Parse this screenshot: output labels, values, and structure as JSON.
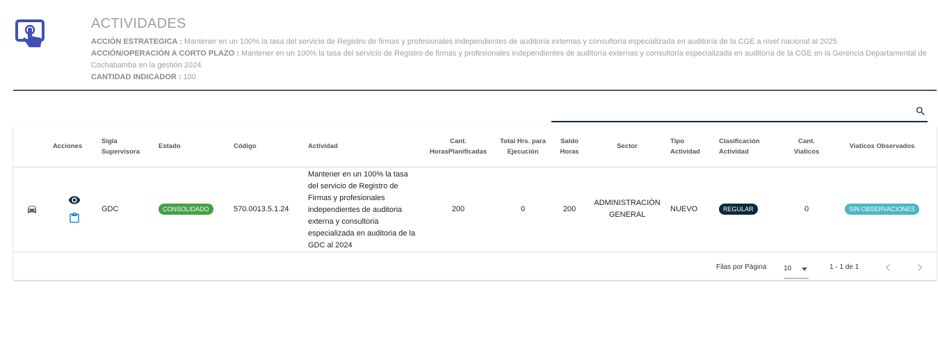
{
  "header": {
    "title": "ACTIVIDADES",
    "accion_estrategica_label": "ACCIÓN ESTRATEGICA :",
    "accion_estrategica_value": " Mantener en un 100% la tasa del servicio de Registro de firmas y profesionales independientes de auditoría externas y consultoría especializada en auditoría de la CGE a nivel nacional al 2025.",
    "accion_corto_plazo_label": "ACCIÓN/OPERACIÓN A CORTO PLAZO :",
    "accion_corto_plazo_value": " Mantener en un 100% la tasa del servicio de Registro de firmas y profesionales independientes de auditoría externas y consultoría especializada en auditoría de la CGE en la Gerencia Departamental de Cochabamba en la gestión 2024.",
    "cantidad_label": "CANTIDAD INDICADOR :",
    "cantidad_value": " 100",
    "icon": "touch-screen-icon"
  },
  "search": {
    "placeholder": "",
    "value": "",
    "icon": "search-icon"
  },
  "table": {
    "headers": {
      "acciones": "Acciones",
      "sigla": "Sigla Supervisora",
      "estado": "Estado",
      "codigo": "Código",
      "actividad": "Actividad",
      "cant_horas": "Cant. HorasPlanificadas",
      "total_hrs": "Total Hrs. para Ejecución",
      "saldo": "Saldo Horas",
      "sector": "Sector",
      "tipo": "Tipo Actividad",
      "clasificacion": "Clasificación Actividad",
      "viaticos": "Cant. Viaticos",
      "viaticos_obs": "Viaticos Observados"
    },
    "rows": [
      {
        "sigla": "GDC",
        "estado": "CONSOLIDADO",
        "codigo": "570.0013.5.1.24",
        "actividad": "Mantener en un 100% la tasa del servicio de Registro de Firmas y profesionales independientes de auditoria externa y consultoria especializada en auditoria de la GDC al 2024",
        "cant_horas": "200",
        "total_hrs": "0",
        "saldo": "200",
        "sector": "ADMINISTRACIÓN GENERAL",
        "tipo": "NUEVO",
        "clasificacion": "REGULAR",
        "viaticos": "0",
        "viaticos_obs": "SIN OBSERVACIONES"
      }
    ]
  },
  "footer": {
    "rows_label": "Filas por Página",
    "rows_value": "10",
    "range": "1 - 1 de 1"
  },
  "colors": {
    "accent": "#3f51b5",
    "navy": "#0b2a3c",
    "green_badge": "#43a047",
    "teal_badge": "#4db6c4",
    "icon_blue": "#1e88e5"
  }
}
